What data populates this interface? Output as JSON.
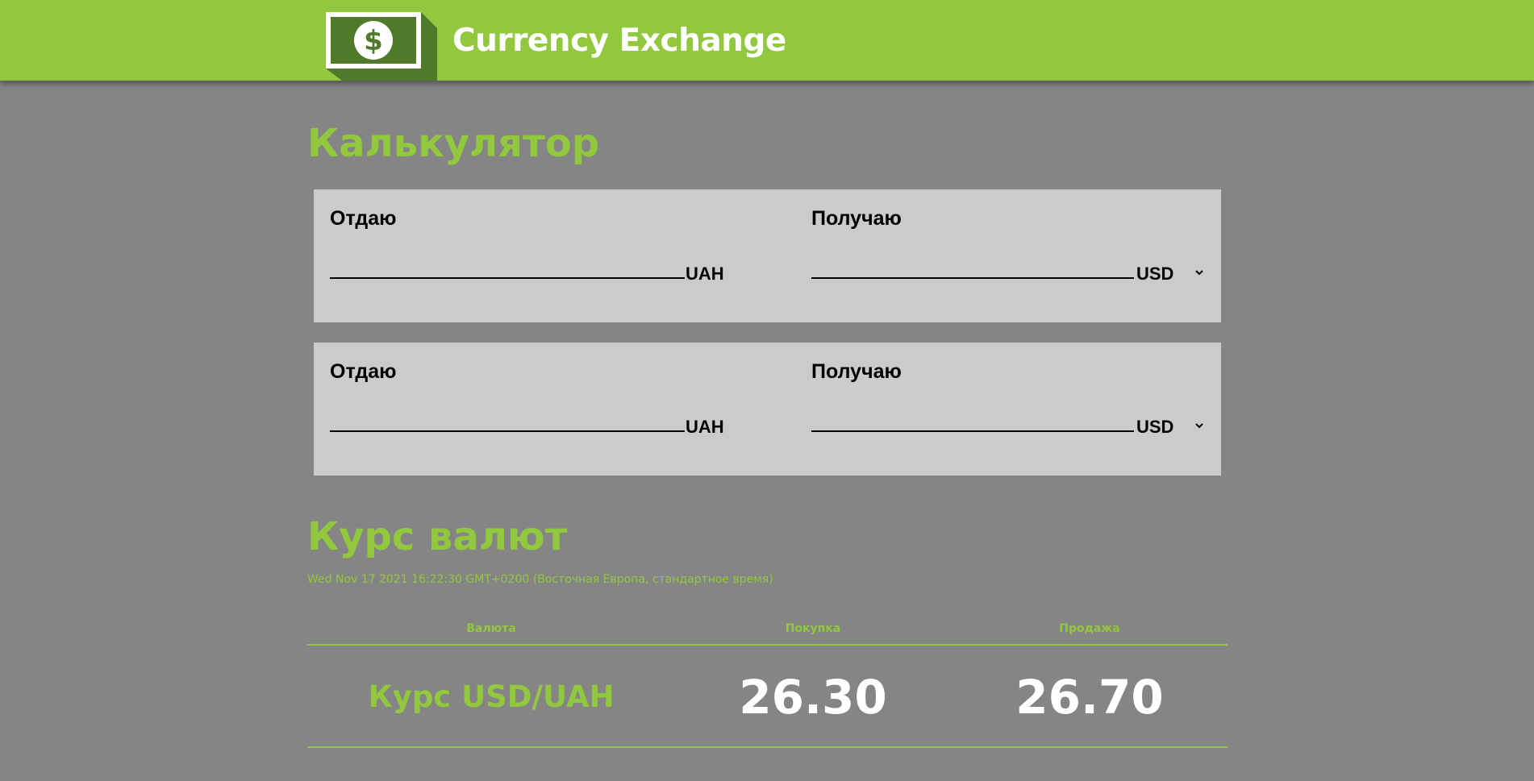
{
  "header": {
    "app_title": "Currency Exchange",
    "brand_color": "#92c83e",
    "logo_icon": "dollar-bill-icon"
  },
  "calculator": {
    "title": "Калькулятор",
    "rows": [
      {
        "give_label": "Отдаю",
        "give_value": "",
        "give_currency": "UAH",
        "get_label": "Получаю",
        "get_value": "",
        "get_currency": "USD"
      },
      {
        "give_label": "Отдаю",
        "give_value": "",
        "give_currency": "UAH",
        "get_label": "Получаю",
        "get_value": "",
        "get_currency": "USD"
      }
    ]
  },
  "rates": {
    "title": "Курс валют",
    "date": "Wed Nov 17 2021 16:22:30 GMT+0200 (Восточная Европа, стандартное время)",
    "columns": [
      "Валюта",
      "Покупка",
      "Продажа"
    ],
    "rows": [
      {
        "pair": "Курс USD/UAH",
        "buy": "26.30",
        "sell": "26.70"
      }
    ]
  }
}
